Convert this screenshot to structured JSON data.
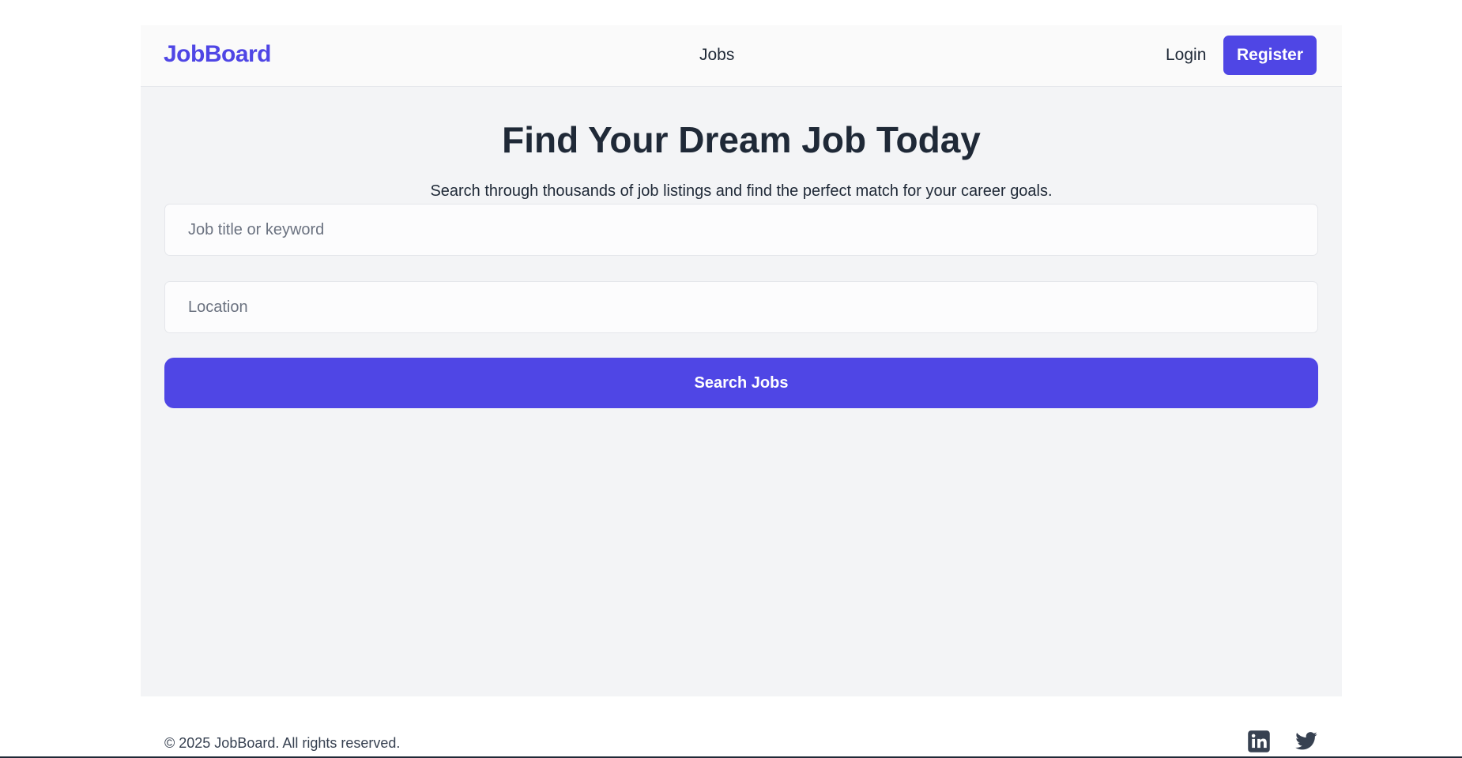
{
  "navbar": {
    "logo": "JobBoard",
    "links": [
      {
        "label": "Jobs"
      }
    ],
    "login_label": "Login",
    "register_label": "Register"
  },
  "hero": {
    "title": "Find Your Dream Job Today",
    "subtitle": "Search through thousands of job listings and find the perfect match for your career goals."
  },
  "search": {
    "keyword": {
      "value": "",
      "placeholder": "Job title or keyword"
    },
    "location": {
      "value": "",
      "placeholder": "Location"
    },
    "button_label": "Search Jobs"
  },
  "footer": {
    "copyright": "© 2025 JobBoard. All rights reserved.",
    "social_icons": [
      "linkedin-icon",
      "twitter-icon"
    ]
  },
  "colors": {
    "brand": "#4f46e5",
    "text": "#1f2937",
    "muted": "#6b7280",
    "content_background": "#f3f4f6"
  }
}
